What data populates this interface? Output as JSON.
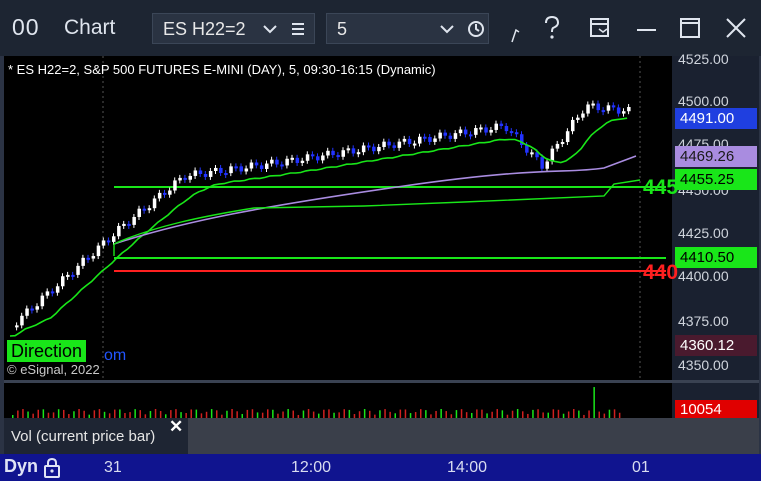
{
  "titlebar": {
    "logo": "00",
    "title": "Chart",
    "symbol_value": "ES H22=2",
    "interval_value": "5",
    "icons": [
      "chevron-down-icon",
      "list-icon",
      "clock-icon",
      "draw-icon",
      "help-icon",
      "layout-icon",
      "minimize-icon",
      "maximize-icon",
      "close-icon"
    ]
  },
  "chart": {
    "caption": "* ES H22=2, S&P 500 FUTURES E-MINI (DAY), 5, 09:30-16:15 (Dynamic)",
    "direction_label": "Direction",
    "direction_tail": "om",
    "copyright": "© eSignal, 2022",
    "line_label_green": "445",
    "line_label_red": "440",
    "axis_ticks": [
      "4525.00",
      "4500.00",
      "4475.00",
      "4450.00",
      "4425.00",
      "4400.00",
      "4375.00",
      "4350.00"
    ],
    "price_tags": [
      {
        "value": "4491.00",
        "bg": "#1f3fe0",
        "fg": "#ffffff"
      },
      {
        "value": "4469.26",
        "bg": "#a98ce0",
        "fg": "#1a1a1a"
      },
      {
        "value": "4455.25",
        "bg": "#19e619",
        "fg": "#000000"
      },
      {
        "value": "4410.50",
        "bg": "#19e619",
        "fg": "#000000"
      },
      {
        "value": "4360.12",
        "bg": "#4a1a2e",
        "fg": "#ffffff"
      }
    ],
    "colors": {
      "up": "#ffffff",
      "down": "#2233ff",
      "fast_ma": "#19e619",
      "slow_ma": "#a98ce0",
      "red_line": "#ff2020"
    }
  },
  "volume": {
    "tooltip": "Vol (current price bar)",
    "close": "✕",
    "tag_value": "10054",
    "tag_bg": "#e00000"
  },
  "timebar": {
    "mode": "Dyn",
    "labels": [
      "31",
      "12:00",
      "14:00",
      "01"
    ]
  }
}
